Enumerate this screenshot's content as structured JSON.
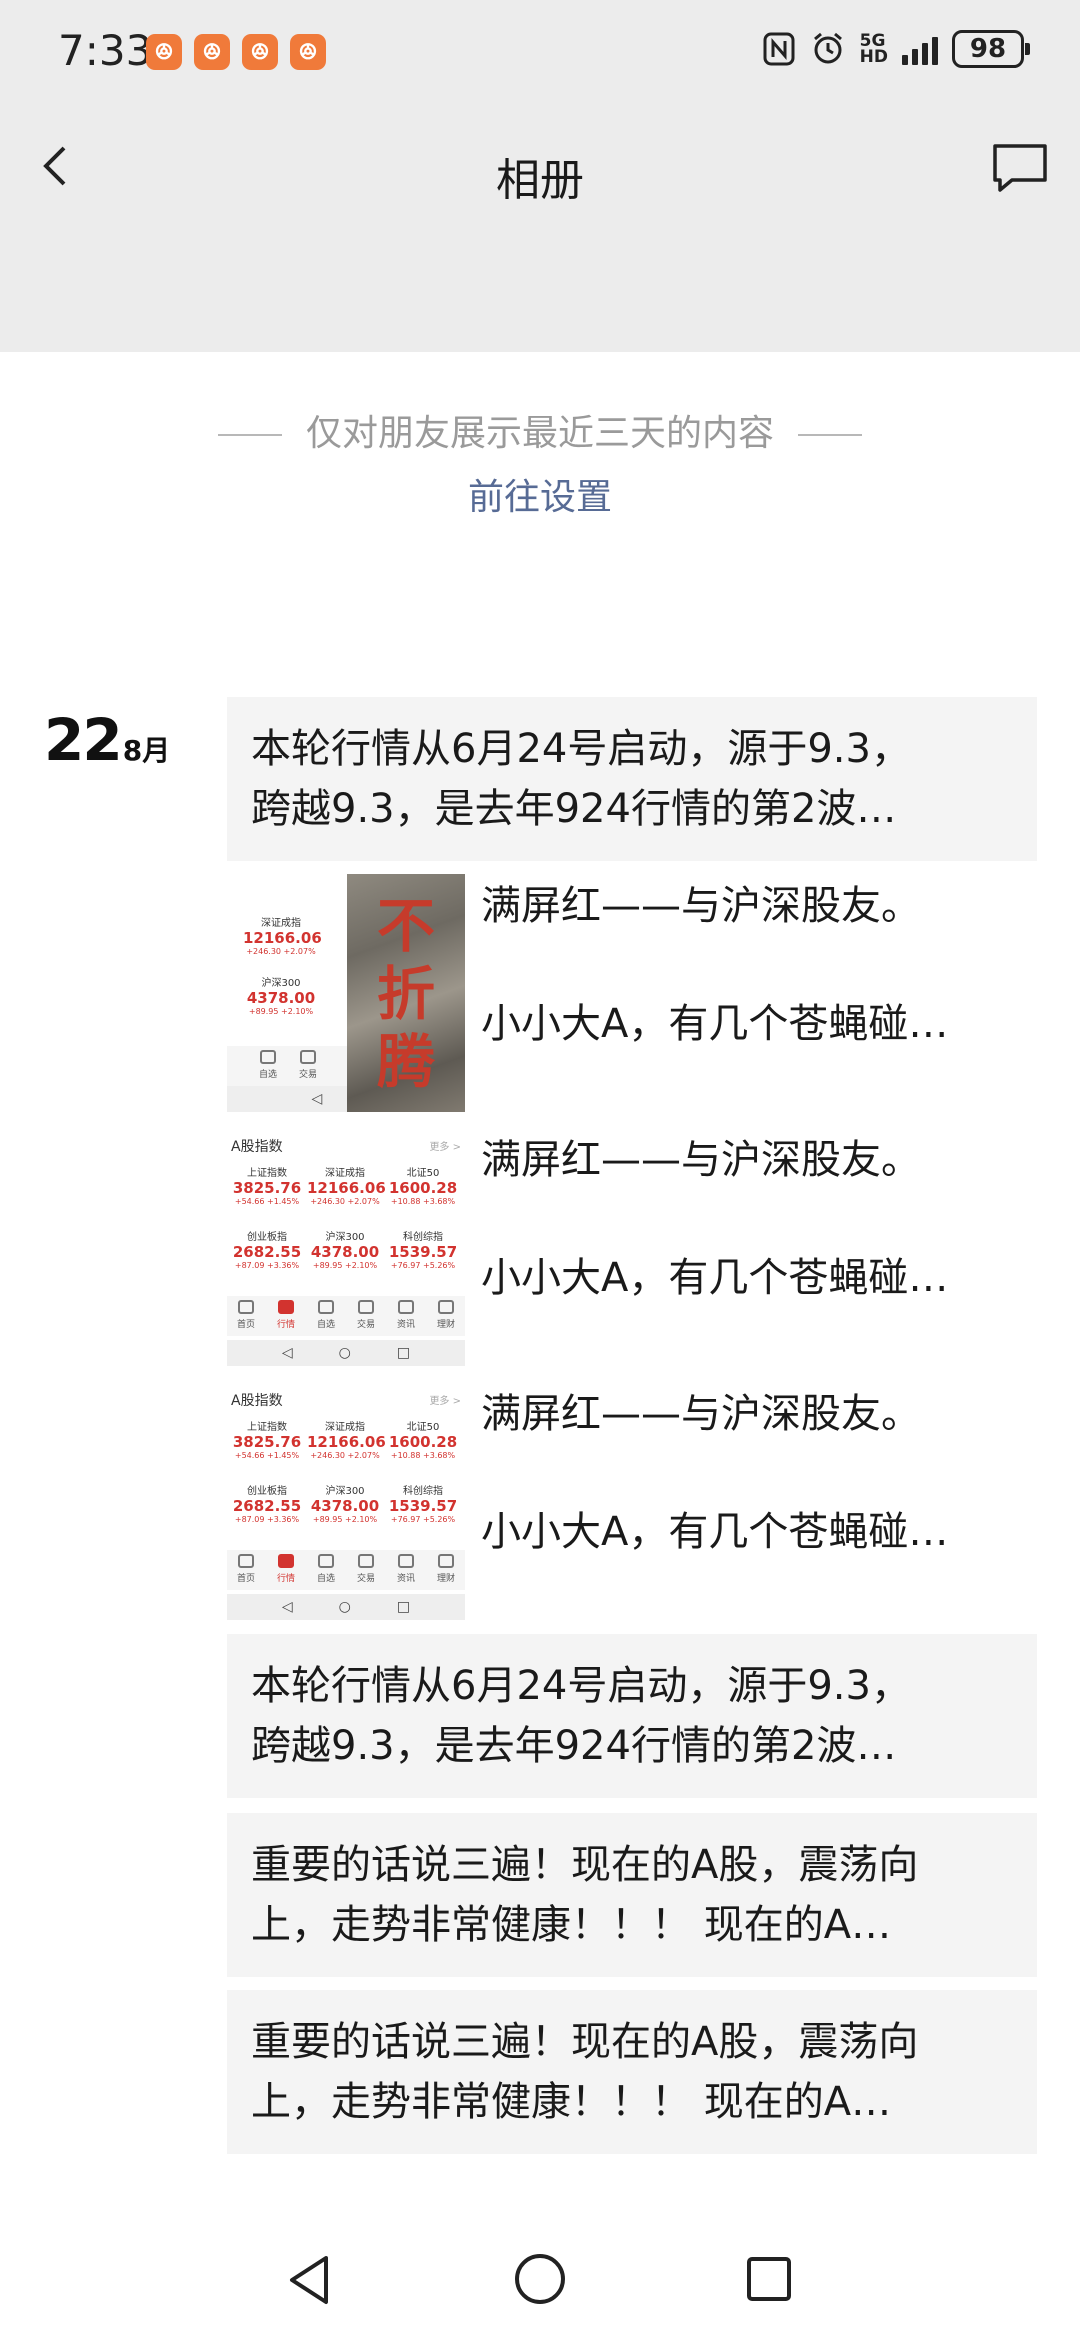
{
  "status_bar": {
    "time": "7:33",
    "notification_app_count": 4,
    "net_label_top": "5G",
    "net_label_bottom": "HD",
    "battery": "98"
  },
  "nav": {
    "title": "相册"
  },
  "privacy": {
    "notice": "仅对朋友展示最近三天的内容",
    "link": "前往设置"
  },
  "date": {
    "day": "22",
    "month": "8月"
  },
  "posts": [
    {
      "type": "text",
      "lines": [
        "本轮行情从6月24号启动，源于9.3，",
        "跨越9.3，是去年924行情的第2波…"
      ]
    },
    {
      "type": "image",
      "caption1": "满屏红——与沪深股友。",
      "caption2": "小小大A，有几个苍蝇碰…",
      "thumb_text": "不折腾"
    },
    {
      "type": "image",
      "caption1": "满屏红——与沪深股友。",
      "caption2": "小小大A，有几个苍蝇碰…"
    },
    {
      "type": "image",
      "caption1": "满屏红——与沪深股友。",
      "caption2": "小小大A，有几个苍蝇碰…"
    },
    {
      "type": "text",
      "lines": [
        "本轮行情从6月24号启动，源于9.3，",
        "跨越9.3，是去年924行情的第2波…"
      ]
    },
    {
      "type": "text",
      "lines": [
        "重要的话说三遍！现在的A股，震荡向",
        "上，走势非常健康！！！ 现在的A…"
      ]
    },
    {
      "type": "text",
      "lines": [
        "重要的话说三遍！现在的A股，震荡向",
        "上，走势非常健康！！！ 现在的A…"
      ]
    }
  ],
  "stock_thumb": {
    "header": "A股指数",
    "more": "更多 >",
    "cells": [
      {
        "name": "上证指数",
        "value": "3825.76",
        "change": "+54.66 +1.45%"
      },
      {
        "name": "深证成指",
        "value": "12166.06",
        "change": "+246.30 +2.07%"
      },
      {
        "name": "北证50",
        "value": "1600.28",
        "change": "+10.88 +3.68%"
      },
      {
        "name": "创业板指",
        "value": "2682.55",
        "change": "+87.09 +3.36%"
      },
      {
        "name": "沪深300",
        "value": "4378.00",
        "change": "+89.95 +2.10%"
      },
      {
        "name": "科创综指",
        "value": "1539.57",
        "change": "+76.97 +5.26%"
      }
    ],
    "tabs": [
      "首页",
      "行情",
      "自选",
      "交易",
      "资讯",
      "理财"
    ],
    "active_tab": "行情"
  },
  "colors": {
    "top_background": "#ececec",
    "link": "#576b95",
    "post_background": "#f4f4f4",
    "stock_red": "#d2332f",
    "notification_orange": "#f07a3a"
  },
  "icons": [
    "back-icon",
    "comment-icon",
    "nfc-icon",
    "alarm-icon",
    "signal-icon",
    "battery-icon",
    "nav-back-icon",
    "nav-home-icon",
    "nav-recents-icon"
  ]
}
